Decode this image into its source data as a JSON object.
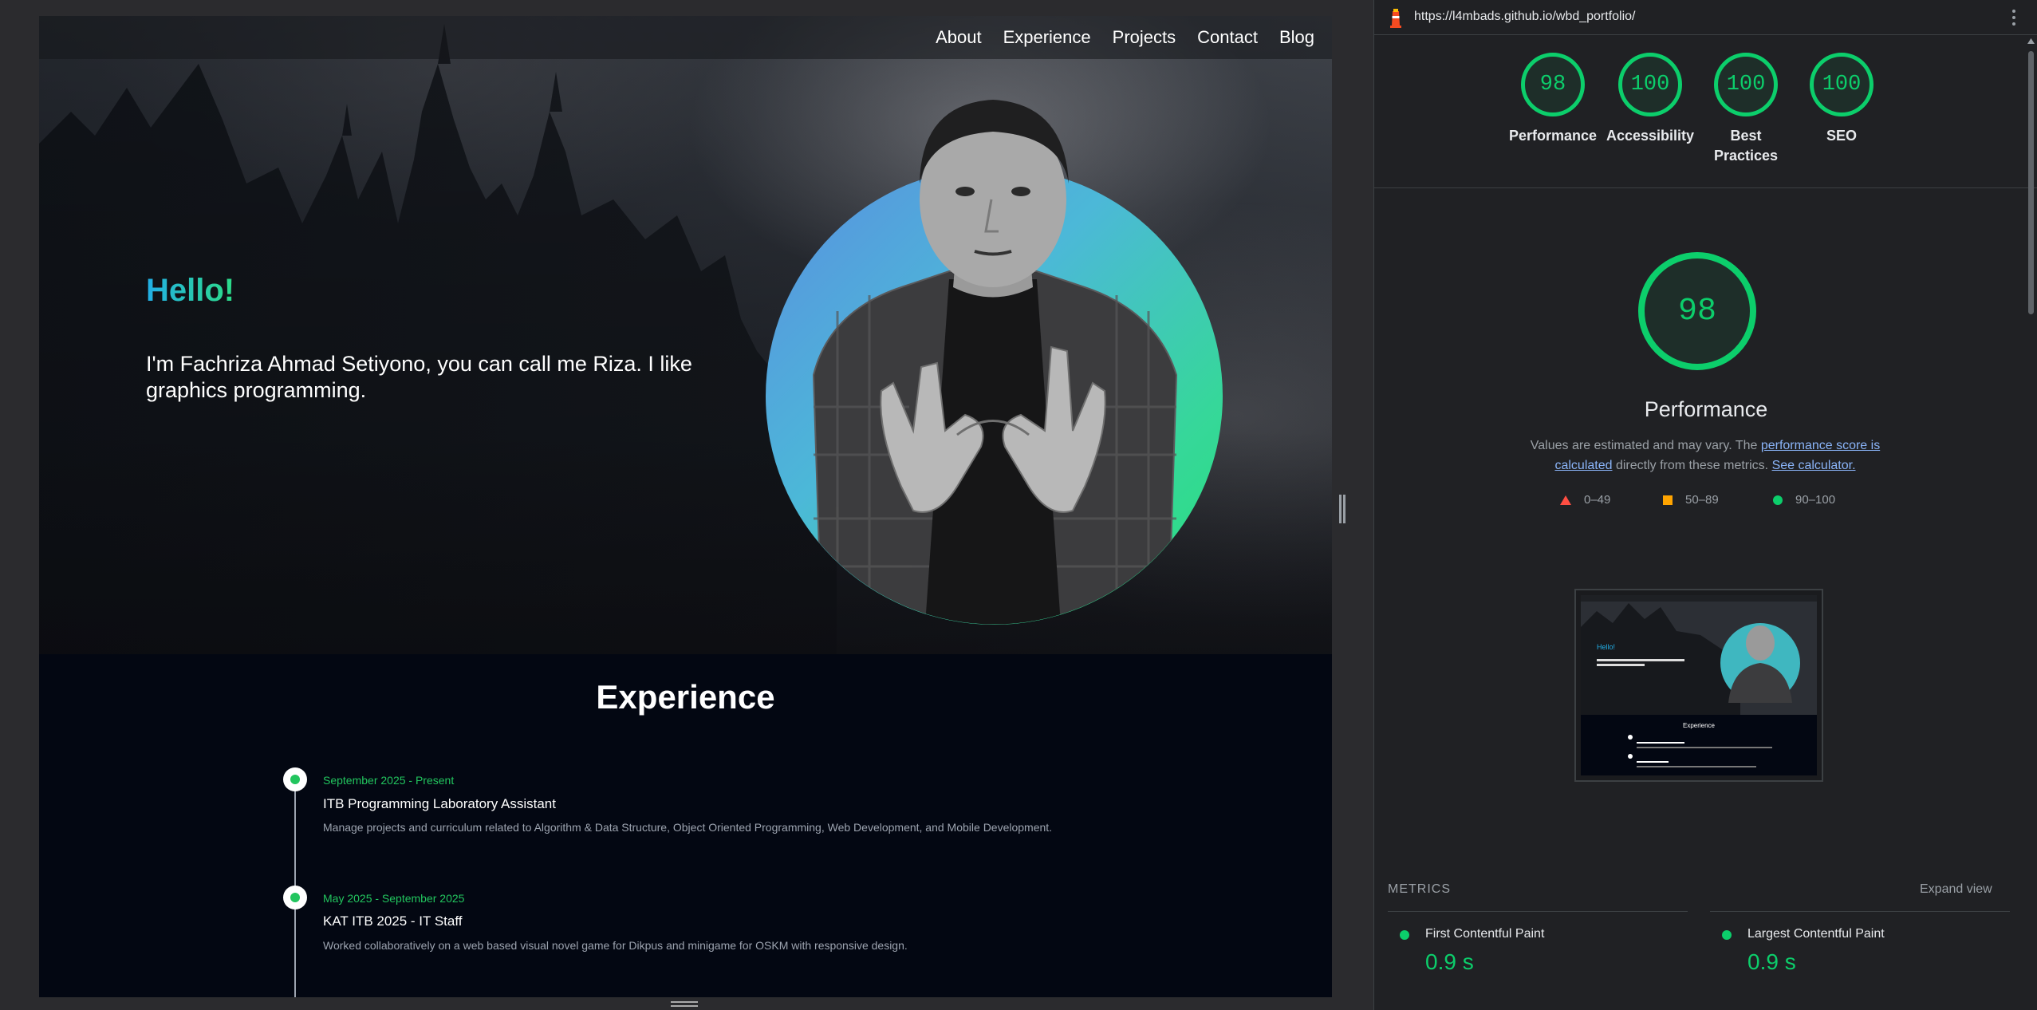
{
  "site": {
    "nav": [
      "About",
      "Experience",
      "Projects",
      "Contact",
      "Blog"
    ],
    "hello": "Hello!",
    "intro": "I'm Fachriza Ahmad Setiyono, you can call me Riza. I like graphics programming.",
    "experience_title": "Experience",
    "experience": [
      {
        "date": "September 2025 - Present",
        "role": "ITB Programming Laboratory Assistant",
        "desc": "Manage projects and curriculum related to Algorithm & Data Structure, Object Oriented Programming, Web Development, and Mobile Development."
      },
      {
        "date": "May 2025 - September 2025",
        "role": "KAT ITB 2025 - IT Staff",
        "desc": "Worked collaboratively on a web based visual novel game for Dikpus and minigame for OSKM with responsive design."
      }
    ]
  },
  "lighthouse": {
    "url": "https://l4mbads.github.io/wbd_portfolio/",
    "gauges": [
      {
        "score": "98",
        "label": "Performance"
      },
      {
        "score": "100",
        "label": "Accessibility"
      },
      {
        "score": "100",
        "label": "Best Practices"
      },
      {
        "score": "100",
        "label": "SEO"
      }
    ],
    "performance_score": "98",
    "performance_title": "Performance",
    "desc_prefix": "Values are estimated and may vary. The ",
    "desc_link1": "performance score is calculated",
    "desc_middle": " directly from these metrics. ",
    "desc_link2": "See calculator.",
    "legend": [
      "0–49",
      "50–89",
      "90–100"
    ],
    "metrics_heading": "METRICS",
    "expand_label": "Expand view",
    "metrics": [
      {
        "name": "First Contentful Paint",
        "value": "0.9 s"
      },
      {
        "name": "Largest Contentful Paint",
        "value": "0.9 s"
      }
    ],
    "colors": {
      "pass": "#0cce6b",
      "average": "#ffa400",
      "fail": "#ff4e42"
    }
  }
}
